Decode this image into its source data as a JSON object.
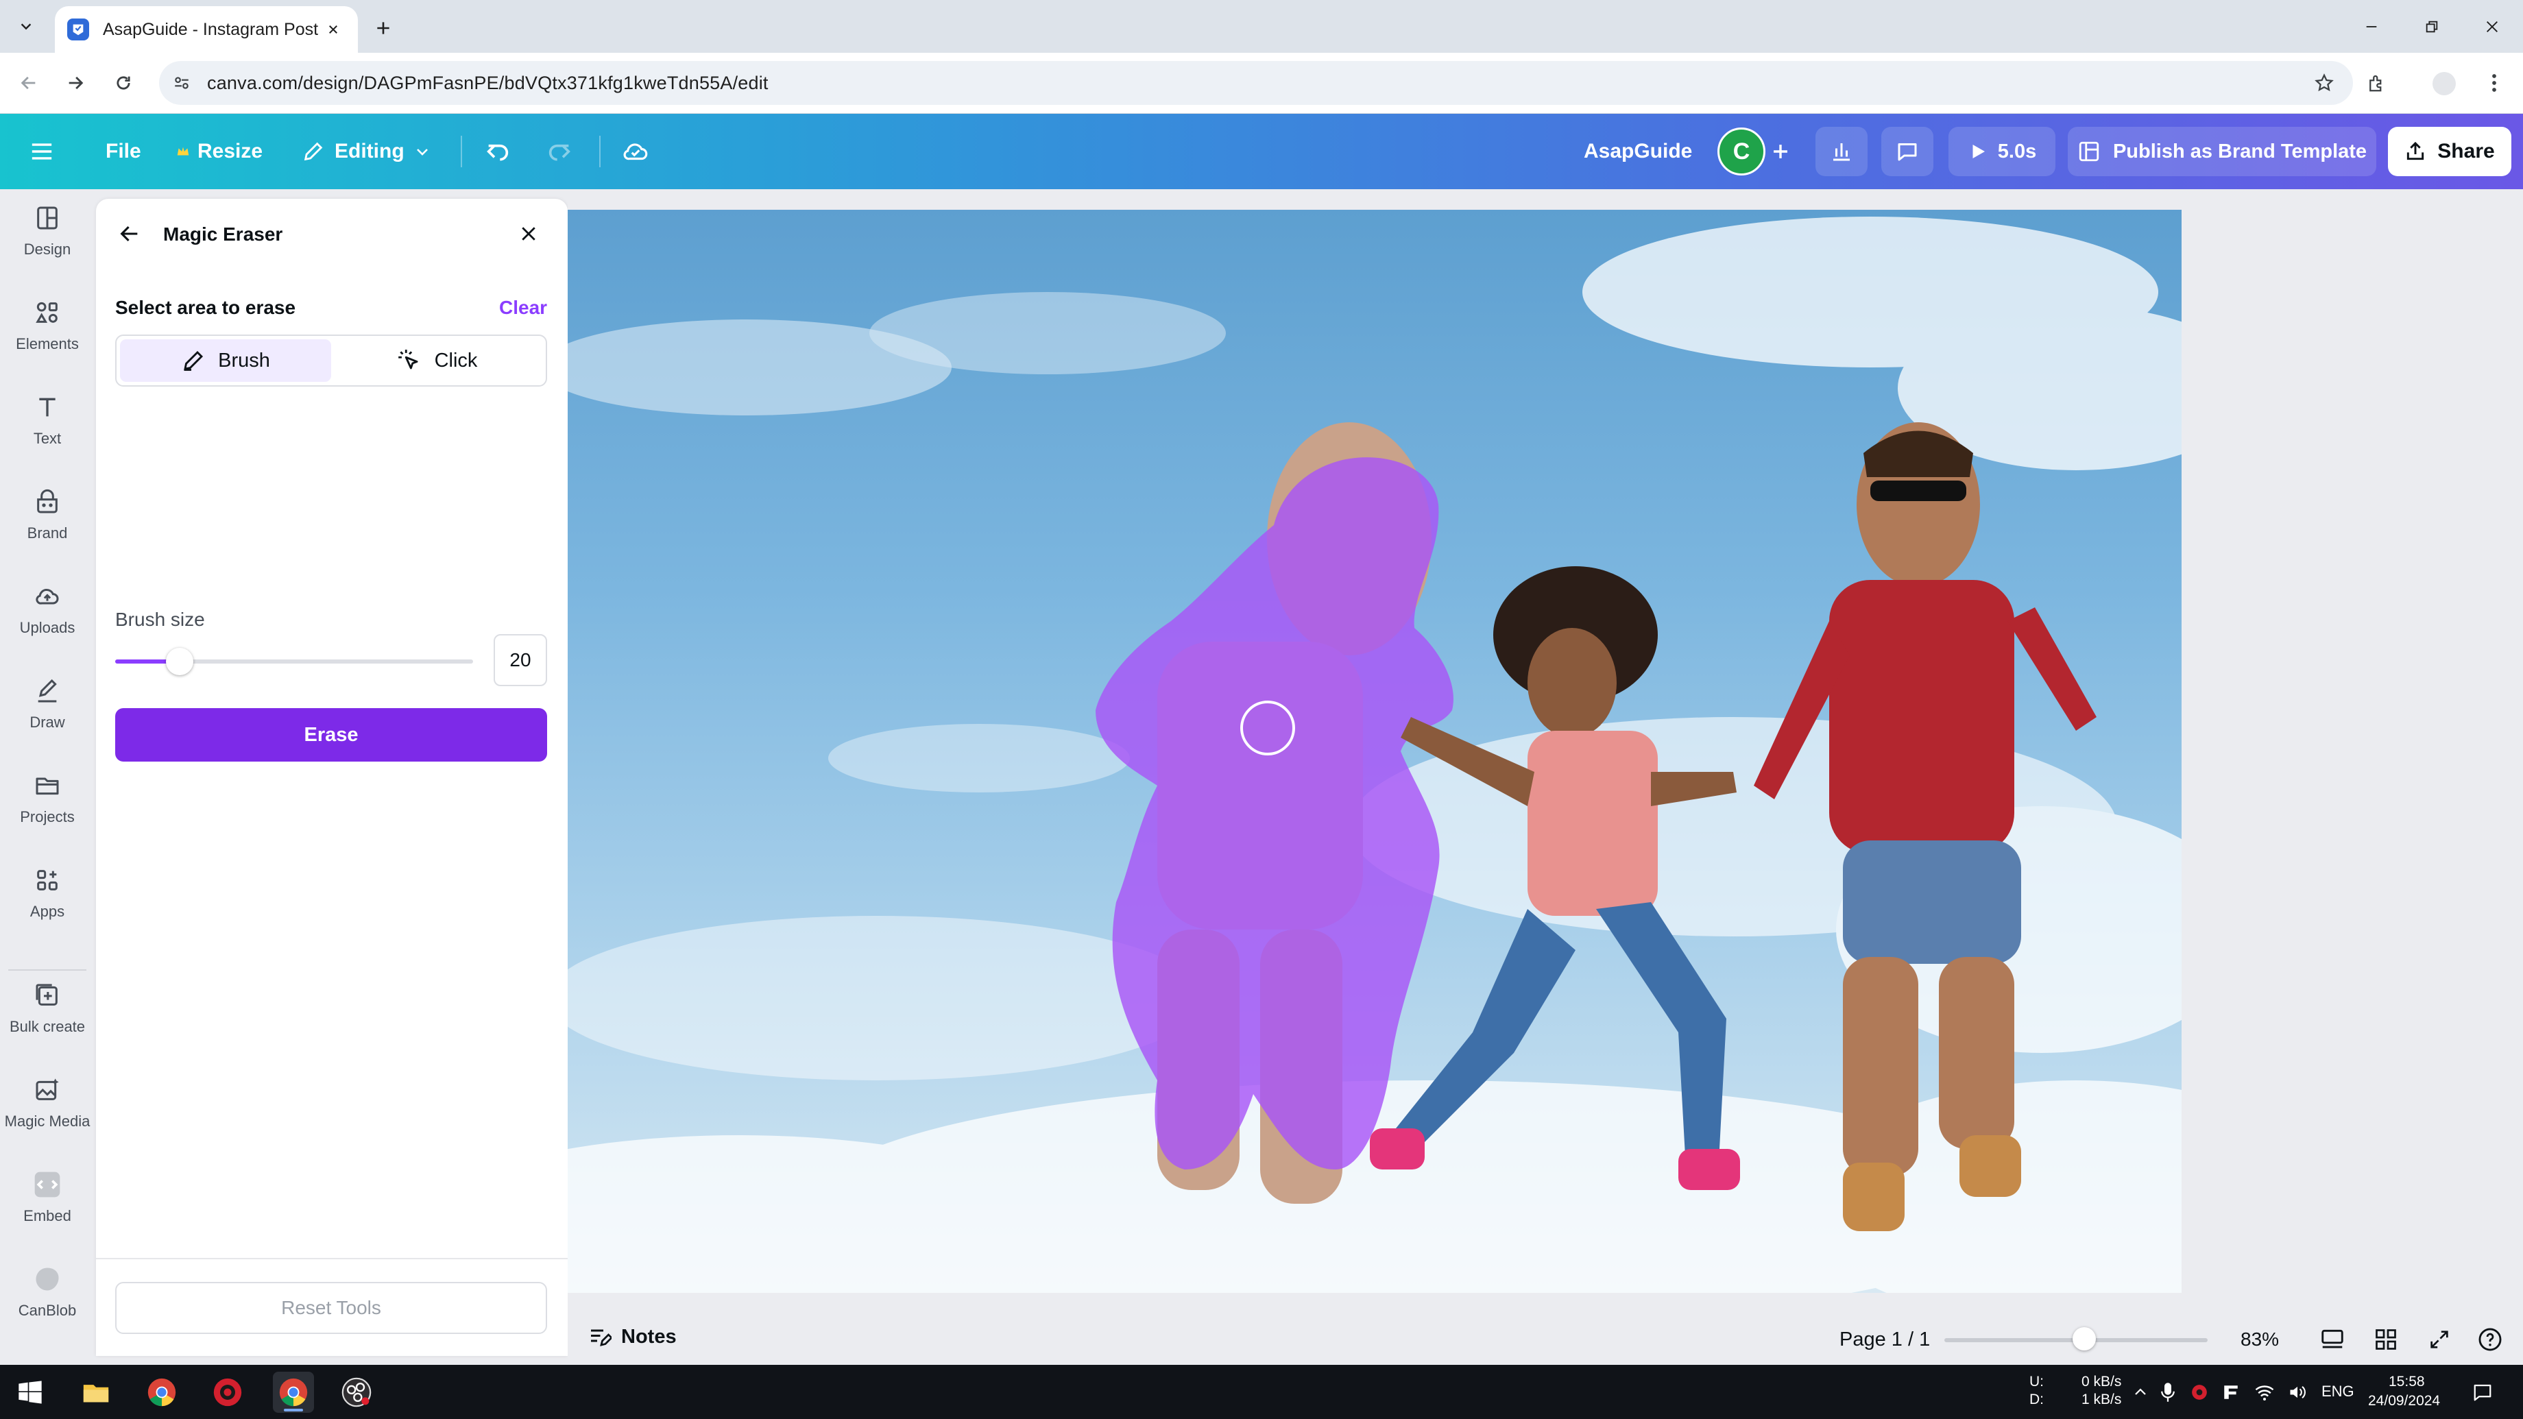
{
  "browser": {
    "tab_title": "AsapGuide - Instagram Post",
    "url": "canva.com/design/DAGPmFasnPE/bdVQtx371kfg1kweTdn55A/edit"
  },
  "header": {
    "file_label": "File",
    "resize_label": "Resize",
    "editing_label": "Editing",
    "design_name": "AsapGuide",
    "avatar_letter": "C",
    "play_duration": "5.0s",
    "publish_label": "Publish as Brand Template",
    "share_label": "Share"
  },
  "rail": {
    "items": [
      {
        "label": "Design",
        "icon": "design-icon"
      },
      {
        "label": "Elements",
        "icon": "elements-icon"
      },
      {
        "label": "Text",
        "icon": "text-icon"
      },
      {
        "label": "Brand",
        "icon": "brand-icon"
      },
      {
        "label": "Uploads",
        "icon": "uploads-icon"
      },
      {
        "label": "Draw",
        "icon": "draw-icon"
      },
      {
        "label": "Projects",
        "icon": "projects-icon"
      },
      {
        "label": "Apps",
        "icon": "apps-icon"
      },
      {
        "label": "Bulk create",
        "icon": "bulk-create-icon"
      },
      {
        "label": "Magic Media",
        "icon": "magic-media-icon"
      },
      {
        "label": "Embed",
        "icon": "embed-icon"
      },
      {
        "label": "CanBlob",
        "icon": "canblob-icon"
      }
    ]
  },
  "panel": {
    "title": "Magic Eraser",
    "select_label": "Select area to erase",
    "clear_label": "Clear",
    "brush_label": "Brush",
    "click_label": "Click",
    "brush_size_label": "Brush size",
    "brush_size_value": "20",
    "brush_size_fraction": 0.18,
    "erase_label": "Erase",
    "reset_label": "Reset Tools"
  },
  "bottom": {
    "notes_label": "Notes",
    "page_indicator": "Page 1 / 1",
    "zoom_label": "83%",
    "zoom_fraction": 0.53
  },
  "taskbar": {
    "net_up_label": "U:",
    "net_down_label": "D:",
    "net_up": "0 kB/s",
    "net_down": "1 kB/s",
    "language": "ENG",
    "time": "15:58",
    "date": "24/09/2024"
  },
  "colors": {
    "accent": "#7d2ae8",
    "link": "#8b3dff",
    "erase_mask": "#a855f7",
    "header_gradient_start": "#18c3cf",
    "header_gradient_end": "#6a58e6"
  }
}
